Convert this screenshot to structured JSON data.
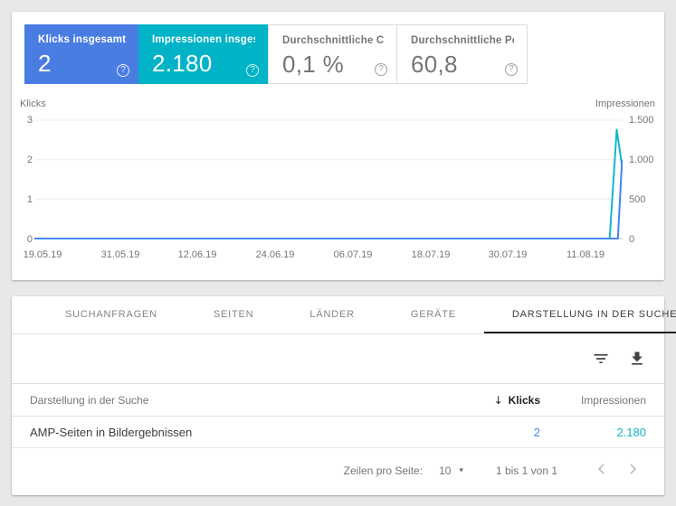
{
  "metric_cards": [
    {
      "title": "Klicks insgesamt",
      "value": "2",
      "bg": "#4a7de2",
      "selected": true
    },
    {
      "title": "Impressionen insges...",
      "value": "2.180",
      "bg": "#00b3c6",
      "selected": true
    },
    {
      "title": "Durchschnittliche CTR",
      "value": "0,1 %",
      "bg": "#ffffff",
      "selected": false
    },
    {
      "title": "Durchschnittliche Po...",
      "value": "60,8",
      "bg": "#ffffff",
      "selected": false
    }
  ],
  "icons": {
    "help": "?",
    "sort_desc": "↓",
    "dropdown_caret": "▾"
  },
  "chart_data": {
    "type": "line",
    "x_ticks": [
      "19.05.19",
      "31.05.19",
      "12.06.19",
      "24.06.19",
      "06.07.19",
      "18.07.19",
      "30.07.19",
      "11.08.19"
    ],
    "left_axis": {
      "label": "Klicks",
      "max": 3,
      "ticks": [
        "3",
        "2",
        "1",
        "0"
      ]
    },
    "right_axis": {
      "label": "Impressionen",
      "max": 1500,
      "ticks": [
        "1.500",
        "1.000",
        "500",
        "0"
      ]
    },
    "grid": true,
    "legend": "none",
    "series": [
      {
        "name": "Klicks",
        "axis": "left",
        "color": "#4285f4",
        "points_fx_value": [
          [
            0,
            0
          ],
          [
            0.992,
            0
          ],
          [
            0.999,
            2
          ]
        ]
      },
      {
        "name": "Impressionen",
        "axis": "right",
        "color": "#12b5cb",
        "points_fx_value": [
          [
            0,
            0
          ],
          [
            0.978,
            0
          ],
          [
            0.99,
            1380
          ],
          [
            1,
            870
          ]
        ]
      }
    ]
  },
  "tabs": [
    {
      "label": "SUCHANFRAGEN",
      "active": false
    },
    {
      "label": "SEITEN",
      "active": false
    },
    {
      "label": "LÄNDER",
      "active": false
    },
    {
      "label": "GERÄTE",
      "active": false
    },
    {
      "label": "DARSTELLUNG IN DER SUCHE",
      "active": true
    }
  ],
  "table": {
    "columns": {
      "dimension": "Darstellung in der Suche",
      "klicks": "Klicks",
      "impressionen": "Impressionen"
    },
    "sort": {
      "column": "Klicks",
      "direction": "desc"
    },
    "rows": [
      {
        "dimension": "AMP-Seiten in Bildergebnissen",
        "klicks": "2",
        "impressionen": "2.180"
      }
    ],
    "value_colors": {
      "klicks": "#4285f4",
      "impressionen": "#12b5cb"
    }
  },
  "pagination": {
    "rows_per_page_label": "Zeilen pro Seite:",
    "rows_per_page": "10",
    "range": "1 bis 1 von 1"
  },
  "colors": {
    "background": "#e8e8e8",
    "panel": "#ffffff",
    "text_muted": "#757575",
    "text_dark": "#202124"
  }
}
